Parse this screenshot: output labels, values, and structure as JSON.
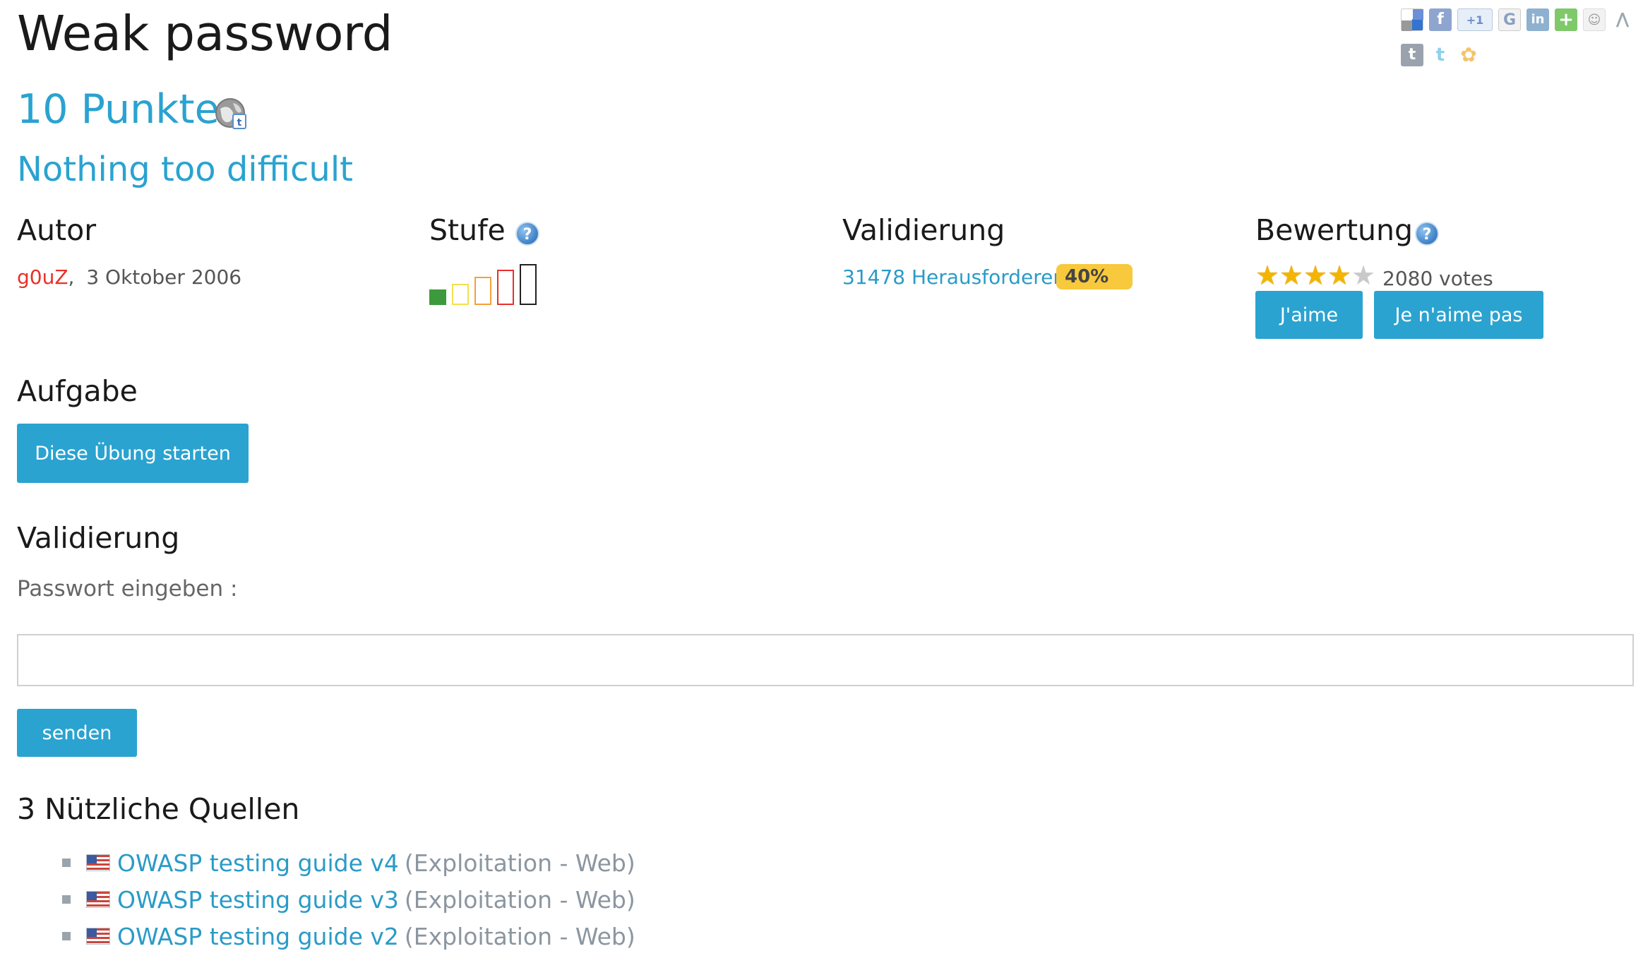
{
  "header": {
    "title": "Weak password",
    "points": "10 Punkte",
    "subtitle": "Nothing too difficult"
  },
  "info": {
    "author": {
      "heading": "Autor",
      "name": "g0uZ",
      "separator": ",",
      "date": "3 Oktober 2006"
    },
    "level": {
      "heading": "Stufe",
      "current": 1,
      "max": 5,
      "colors": [
        "#3c9a3c",
        "#f4e04d",
        "#f4a13c",
        "#e8302a",
        "#222222"
      ]
    },
    "validation": {
      "heading": "Validierung",
      "challengers": "31478 Herausforderer",
      "percent": "40%"
    },
    "rating": {
      "heading": "Bewertung",
      "stars": 4,
      "max_stars": 5,
      "votes": "2080 votes",
      "like_label": "J'aime",
      "dislike_label": "Je n'aime pas"
    }
  },
  "task": {
    "heading": "Aufgabe",
    "start_label": "Diese Übung starten"
  },
  "validation_form": {
    "heading": "Validierung",
    "label": "Passwort eingeben :",
    "value": "",
    "submit_label": "senden"
  },
  "resources": {
    "heading": "3 Nützliche Quellen",
    "items": [
      {
        "title": "OWASP testing guide v4",
        "category": "(Exploitation - Web)"
      },
      {
        "title": "OWASP testing guide v3",
        "category": "(Exploitation - Web)"
      },
      {
        "title": "OWASP testing guide v2",
        "category": "(Exploitation - Web)"
      }
    ]
  },
  "share_icons": [
    "delicious-icon",
    "facebook-icon",
    "google-plus-one-icon",
    "google-icon",
    "linkedin-icon",
    "add-share-icon",
    "reddit-icon",
    "viadeo-icon",
    "tumblr-icon",
    "twitter-icon",
    "netvibes-icon"
  ],
  "colors": {
    "accent": "#2aa3d0",
    "author": "#e8302a",
    "badge": "#f8c93c"
  }
}
